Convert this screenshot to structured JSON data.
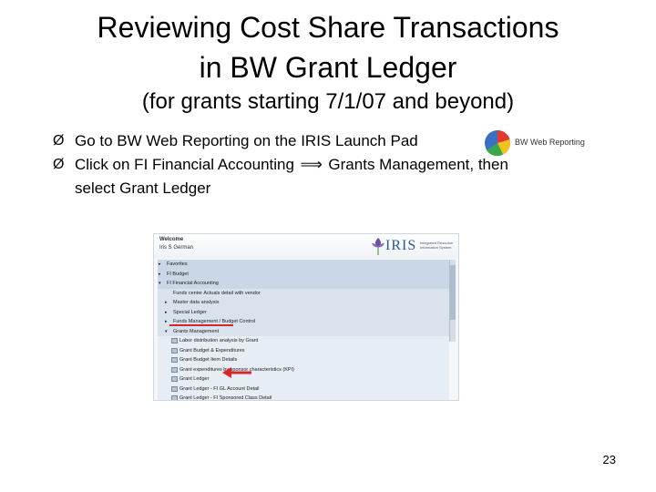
{
  "title": {
    "line1": "Reviewing Cost Share Transactions",
    "line2": "in BW Grant Ledger"
  },
  "subtitle": "(for grants starting 7/1/07 and beyond)",
  "bullets": [
    {
      "mark": "Ø",
      "text": "Go to BW Web Reporting on the IRIS Launch Pad"
    },
    {
      "mark": "Ø",
      "text_before": "Click on FI Financial Accounting",
      "arrow": "⟹",
      "text_after": "Grants Management, then",
      "text_line2": "select Grant Ledger"
    }
  ],
  "bw_icon": {
    "icon": "bw-web-reporting-pie-icon",
    "caption": "BW Web Reporting"
  },
  "screenshot": {
    "welcome": "Welcome",
    "user": "Iris S German",
    "logo_text": "IRIS",
    "logo_tagline": "Integrated Resource Information System",
    "tree": [
      {
        "label": "Favorites",
        "level": 0,
        "toggle": "▸"
      },
      {
        "label": "FI Budget",
        "level": 0,
        "toggle": "▸"
      },
      {
        "label": "FI Financial Accounting",
        "level": 0,
        "toggle": "▾"
      },
      {
        "label": "Funds center Actuals detail with vendor",
        "level": 1,
        "toggle": ""
      },
      {
        "label": "Master data analysis",
        "level": 1,
        "toggle": "▸"
      },
      {
        "label": "Special Ledger",
        "level": 1,
        "toggle": "▸"
      },
      {
        "label": "Funds Management / Budget Control",
        "level": 1,
        "toggle": "▸"
      },
      {
        "label": "Grants Management",
        "level": 1,
        "toggle": "▾"
      },
      {
        "label": "Labor distribution analysis by Grant",
        "level": 2,
        "toggle": ""
      },
      {
        "label": "Grant Budget & Expenditures",
        "level": 2,
        "toggle": ""
      },
      {
        "label": "Grant Budget Item Details",
        "level": 2,
        "toggle": ""
      },
      {
        "label": "Grant expenditures by sponsor characteristics (KPI)",
        "level": 2,
        "toggle": ""
      },
      {
        "label": "Grant Ledger",
        "level": 2,
        "toggle": ""
      },
      {
        "label": "Grant Ledger - FI GL Account Detail",
        "level": 2,
        "toggle": ""
      },
      {
        "label": "Grant Ledger - FI Sponsored Class Detail",
        "level": 2,
        "toggle": ""
      }
    ]
  },
  "page_number": "23",
  "colors": {
    "highlight": "#d7262b",
    "tree_header": "#c9d7e6",
    "logo_blue": "#2a5a9a"
  }
}
